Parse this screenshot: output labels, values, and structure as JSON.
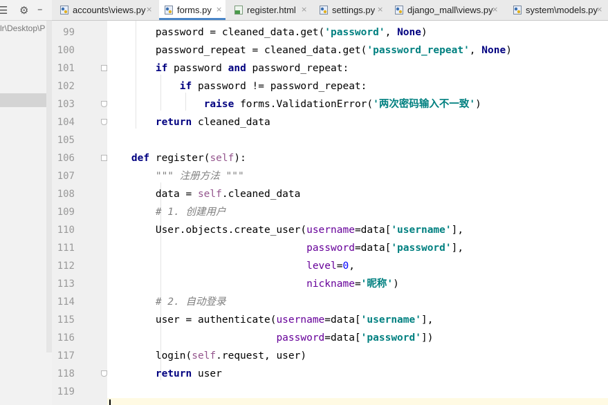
{
  "project_panel": {
    "path_text": "lr\\Desktop\\P"
  },
  "tabs": [
    {
      "label": "accounts\\views.py",
      "icon": "python-file-icon",
      "active": false
    },
    {
      "label": "forms.py",
      "icon": "python-file-icon",
      "active": true
    },
    {
      "label": "register.html",
      "icon": "html-file-icon",
      "active": false
    },
    {
      "label": "settings.py",
      "icon": "python-file-icon",
      "active": false
    },
    {
      "label": "django_mall\\views.py",
      "icon": "python-file-icon",
      "active": false
    },
    {
      "label": "system\\models.py",
      "icon": "python-file-icon",
      "active": false
    }
  ],
  "close_glyph": "×",
  "colors": {
    "keyword": "#000080",
    "string": "#008080",
    "self": "#94558d",
    "comment": "#808080",
    "kwarg": "#660099",
    "number": "#0000ff",
    "active_tab_underline": "#4a86c8"
  },
  "editor": {
    "line_numbers": [
      "99",
      "100",
      "101",
      "102",
      "103",
      "104",
      "105",
      "106",
      "107",
      "108",
      "109",
      "110",
      "111",
      "112",
      "113",
      "114",
      "115",
      "116",
      "117",
      "118",
      "119"
    ],
    "lines": [
      [
        {
          "t": "        password = cleaned_data.get("
        },
        {
          "t": "'password'",
          "c": "str"
        },
        {
          "t": ", "
        },
        {
          "t": "None",
          "c": "kw"
        },
        {
          "t": ")"
        }
      ],
      [
        {
          "t": "        password_repeat = cleaned_data.get("
        },
        {
          "t": "'password_repeat'",
          "c": "str"
        },
        {
          "t": ", "
        },
        {
          "t": "None",
          "c": "kw"
        },
        {
          "t": ")"
        }
      ],
      [
        {
          "t": "        "
        },
        {
          "t": "if",
          "c": "kw"
        },
        {
          "t": " password "
        },
        {
          "t": "and",
          "c": "kw"
        },
        {
          "t": " password_repeat:"
        }
      ],
      [
        {
          "t": "            "
        },
        {
          "t": "if",
          "c": "kw"
        },
        {
          "t": " password != password_repeat:"
        }
      ],
      [
        {
          "t": "                "
        },
        {
          "t": "raise",
          "c": "kw"
        },
        {
          "t": " forms.ValidationError("
        },
        {
          "t": "'两次密码输入不一致'",
          "c": "str"
        },
        {
          "t": ")"
        }
      ],
      [
        {
          "t": "        "
        },
        {
          "t": "return",
          "c": "kw"
        },
        {
          "t": " cleaned_data"
        }
      ],
      [],
      [
        {
          "t": "    "
        },
        {
          "t": "def",
          "c": "kw"
        },
        {
          "t": " register("
        },
        {
          "t": "self",
          "c": "self"
        },
        {
          "t": "):"
        }
      ],
      [
        {
          "t": "        "
        },
        {
          "t": "\"\"\" 注册方法 \"\"\"",
          "c": "cm"
        }
      ],
      [
        {
          "t": "        data = "
        },
        {
          "t": "self",
          "c": "self"
        },
        {
          "t": ".cleaned_data"
        }
      ],
      [
        {
          "t": "        "
        },
        {
          "t": "# 1. 创建用户",
          "c": "cm"
        }
      ],
      [
        {
          "t": "        User.objects.create_user("
        },
        {
          "t": "username",
          "c": "kwarg"
        },
        {
          "t": "=data["
        },
        {
          "t": "'username'",
          "c": "str"
        },
        {
          "t": "],"
        }
      ],
      [
        {
          "t": "                                 "
        },
        {
          "t": "password",
          "c": "kwarg"
        },
        {
          "t": "=data["
        },
        {
          "t": "'password'",
          "c": "str"
        },
        {
          "t": "],"
        }
      ],
      [
        {
          "t": "                                 "
        },
        {
          "t": "level",
          "c": "kwarg"
        },
        {
          "t": "="
        },
        {
          "t": "0",
          "c": "num"
        },
        {
          "t": ","
        }
      ],
      [
        {
          "t": "                                 "
        },
        {
          "t": "nickname",
          "c": "kwarg"
        },
        {
          "t": "="
        },
        {
          "t": "'昵称'",
          "c": "str"
        },
        {
          "t": ")"
        }
      ],
      [
        {
          "t": "        "
        },
        {
          "t": "# 2. 自动登录",
          "c": "cm"
        }
      ],
      [
        {
          "t": "        user = authenticate("
        },
        {
          "t": "username",
          "c": "kwarg"
        },
        {
          "t": "=data["
        },
        {
          "t": "'username'",
          "c": "str"
        },
        {
          "t": "],"
        }
      ],
      [
        {
          "t": "                            "
        },
        {
          "t": "password",
          "c": "kwarg"
        },
        {
          "t": "=data["
        },
        {
          "t": "'password'",
          "c": "str"
        },
        {
          "t": "])"
        }
      ],
      [
        {
          "t": "        login("
        },
        {
          "t": "self",
          "c": "self"
        },
        {
          "t": ".request, user)"
        }
      ],
      [
        {
          "t": "        "
        },
        {
          "t": "return",
          "c": "kw"
        },
        {
          "t": " user"
        }
      ],
      []
    ]
  }
}
